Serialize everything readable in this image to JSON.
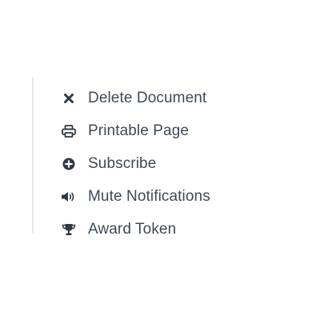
{
  "menu": {
    "items": [
      {
        "label": "Delete Document",
        "icon": "close-icon"
      },
      {
        "label": "Printable Page",
        "icon": "print-icon"
      },
      {
        "label": "Subscribe",
        "icon": "plus-circle-icon"
      },
      {
        "label": "Mute Notifications",
        "icon": "volume-icon"
      },
      {
        "label": "Award Token",
        "icon": "trophy-icon"
      }
    ]
  },
  "colors": {
    "text": "#3f4a56",
    "icon": "#2f3a46",
    "divider": "#e6e8eb",
    "background": "#ffffff"
  }
}
